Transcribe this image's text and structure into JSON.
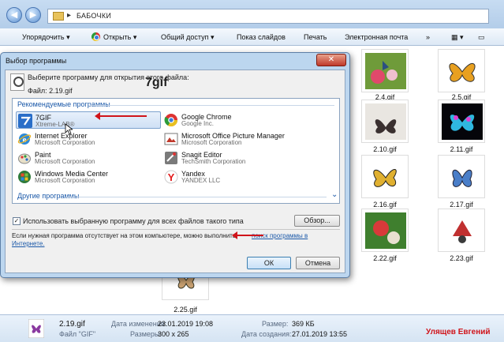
{
  "explorer": {
    "breadcrumb": "БАБОЧКИ",
    "commands": [
      "Упорядочить",
      "Открыть",
      "Общий доступ",
      "Показ слайдов",
      "Печать",
      "Электронная почта"
    ],
    "thumbs": [
      "2.4.gif",
      "2.5.gif",
      "2.10.gif",
      "2.11.gif",
      "2.16.gif",
      "2.17.gif",
      "2.22.gif",
      "2.23.gif",
      "2.25.gif"
    ],
    "details": {
      "name": "2.19.gif",
      "type_label": "Файл \"GIF\"",
      "modified_key": "Дата изменения:",
      "modified_val": "23.01.2019 19:08",
      "dims_key": "Размеры:",
      "dims_val": "300 x 265",
      "size_key": "Размер:",
      "size_val": "369 КБ",
      "created_key": "Дата создания:",
      "created_val": "27.01.2019 13:55"
    },
    "author": "Улящев Евгений"
  },
  "dialog": {
    "title": "Выбор программы",
    "prompt": "Выберите программу для открытия этого файла:",
    "file_label": "Файл:  2.19.gif",
    "big_name": "7gif",
    "recommended_header": "Рекомендуемые программы",
    "programs": [
      {
        "name": "7GIF",
        "publisher": "Xtreme-LAB®"
      },
      {
        "name": "Google Chrome",
        "publisher": "Google Inc."
      },
      {
        "name": "Internet Explorer",
        "publisher": "Microsoft Corporation"
      },
      {
        "name": "Microsoft Office Picture Manager",
        "publisher": "Microsoft Corporation"
      },
      {
        "name": "Paint",
        "publisher": "Microsoft Corporation"
      },
      {
        "name": "Snagit Editor",
        "publisher": "TechSmith Corporation"
      },
      {
        "name": "Windows Media Center",
        "publisher": "Microsoft Corporation"
      },
      {
        "name": "Yandex",
        "publisher": "YANDEX LLC"
      }
    ],
    "other_header": "Другие программы",
    "always_use": "Использовать выбранную программу для всех файлов такого типа",
    "always_checked": "✓",
    "browse": "Обзор...",
    "hint_line1": "Если нужная программа отсутствует на этом компьютере, можно выполнить",
    "hint_link": "поиск программы в",
    "hint_line2": "Интернете.",
    "ok": "ОК",
    "cancel": "Отмена"
  }
}
